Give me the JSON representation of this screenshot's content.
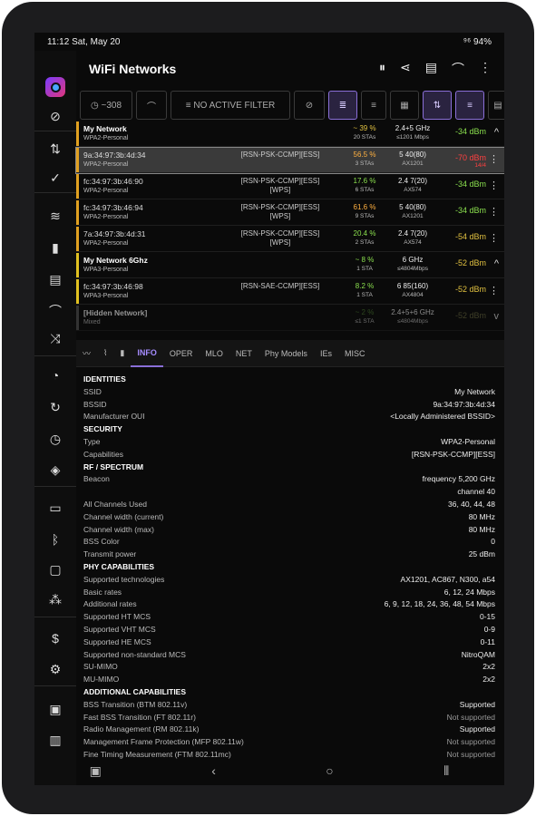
{
  "status": {
    "time": "11:12",
    "date": "Sat, May 20",
    "right": "⁹⁶ 94%"
  },
  "app": {
    "title": "WiFi Networks"
  },
  "filter": {
    "timer": "~308",
    "no_filter": "NO ACTIVE FILTER"
  },
  "networks": [
    {
      "kind": "group",
      "name": "My Network",
      "security": "WPA2-Personal",
      "ch": "~ 39 %",
      "ch_sub": "20 STAs",
      "freq": "2.4+5 GHz",
      "freq_sub": "≤1201 Mbps",
      "sig": "-34 dBm",
      "sig_sub": "",
      "color": "#e0a020",
      "sig_color": "#8be04e",
      "ch_color": "#e0c040",
      "tail": "^"
    },
    {
      "kind": "ap",
      "name": "9a:34:97:3b:4d:34",
      "security": "WPA2-Personal",
      "sec": "[RSN-PSK-CCMP][ESS]",
      "ch": "56.5 %",
      "ch_sub": "3 STAs",
      "freq": "5 40(80)",
      "freq_sub": "AX1201",
      "sig": "-70 dBm",
      "sig_sub": "14/4",
      "color": "#e0a020",
      "sig_color": "#ff4040",
      "ch_color": "#ffb040",
      "tail": "⋮",
      "selected": true
    },
    {
      "kind": "ap",
      "name": "fc:34:97:3b:46:90",
      "security": "WPA2-Personal",
      "sec": "[RSN-PSK-CCMP][ESS] [WPS]",
      "ch": "17.6 %",
      "ch_sub": "6 STAs",
      "freq": "2.4 7(20)",
      "freq_sub": "AX574",
      "sig": "-34 dBm",
      "sig_sub": "",
      "color": "#e0a020",
      "sig_color": "#8be04e",
      "ch_color": "#8be04e",
      "tail": "⋮"
    },
    {
      "kind": "ap",
      "name": "fc:34:97:3b:46:94",
      "security": "WPA2-Personal",
      "sec": "[RSN-PSK-CCMP][ESS] [WPS]",
      "ch": "61.6 %",
      "ch_sub": "9 STAs",
      "freq": "5 40(80)",
      "freq_sub": "AX1201",
      "sig": "-34 dBm",
      "sig_sub": "",
      "color": "#e0a020",
      "sig_color": "#8be04e",
      "ch_color": "#ffb040",
      "tail": "⋮"
    },
    {
      "kind": "ap",
      "name": "7a:34:97:3b:4d:31",
      "security": "WPA2-Personal",
      "sec": "[RSN-PSK-CCMP][ESS] [WPS]",
      "ch": "20.4 %",
      "ch_sub": "2 STAs",
      "freq": "2.4 7(20)",
      "freq_sub": "AX574",
      "sig": "-54 dBm",
      "sig_sub": "",
      "color": "#e0a020",
      "sig_color": "#e0c040",
      "ch_color": "#8be04e",
      "tail": "⋮"
    },
    {
      "kind": "group",
      "name": "My Network 6Ghz",
      "security": "WPA3-Personal",
      "ch": "~ 8 %",
      "ch_sub": "1 STA",
      "freq": "6 GHz",
      "freq_sub": "≤4804Mbps",
      "sig": "-52 dBm",
      "sig_sub": "",
      "color": "#e0c020",
      "sig_color": "#e0c040",
      "ch_color": "#8be04e",
      "tail": "^"
    },
    {
      "kind": "ap",
      "name": "fc:34:97:3b:46:98",
      "security": "WPA3-Personal",
      "sec": "[RSN-SAE-CCMP][ESS]",
      "ch": "8.2 %",
      "ch_sub": "1 STA",
      "freq": "6 85(160)",
      "freq_sub": "AX4804",
      "sig": "-52 dBm",
      "sig_sub": "",
      "color": "#e0c020",
      "sig_color": "#e0c040",
      "ch_color": "#8be04e",
      "tail": "⋮"
    },
    {
      "kind": "group",
      "name": "[Hidden Network]",
      "security": "Mixed",
      "ch": "~ 2 %",
      "ch_sub": "≤1 STA",
      "freq": "2.4+5+6 GHz",
      "freq_sub": "≤4804Mbps",
      "sig": "-52 dBm",
      "sig_sub": "",
      "color": "#555",
      "sig_color": "#6a6a40",
      "ch_color": "#4a7a30",
      "tail": "v",
      "dim": true
    }
  ],
  "tabs": [
    "INFO",
    "OPER",
    "MLO",
    "NET",
    "Phy Models",
    "IEs",
    "MISC"
  ],
  "info": [
    {
      "h": "IDENTITIES"
    },
    {
      "k": "SSID",
      "v": "My Network"
    },
    {
      "k": "BSSID",
      "v": "9a:34:97:3b:4d:34"
    },
    {
      "k": "Manufacturer OUI",
      "v": "<Locally Administered BSSID>"
    },
    {
      "h": "SECURITY"
    },
    {
      "k": "Type",
      "v": "WPA2-Personal"
    },
    {
      "k": "Capabilities",
      "v": "[RSN-PSK-CCMP][ESS]"
    },
    {
      "h": "RF / SPECTRUM"
    },
    {
      "k": "Beacon",
      "v": "frequency 5,200 GHz"
    },
    {
      "k": "",
      "v": "channel 40"
    },
    {
      "k": "All Channels Used",
      "v": "36, 40, 44, 48"
    },
    {
      "k": "Channel width (current)",
      "v": "80 MHz"
    },
    {
      "k": "Channel width (max)",
      "v": "80 MHz"
    },
    {
      "k": "BSS Color",
      "v": "0"
    },
    {
      "k": "Transmit power",
      "v": "25 dBm"
    },
    {
      "h": "PHY CAPABILITIES"
    },
    {
      "k": "Supported technologies",
      "v": "AX1201, AC867, N300, a54"
    },
    {
      "k": "Basic rates",
      "v": "6, 12, 24 Mbps"
    },
    {
      "k": "Additional rates",
      "v": "6, 9, 12, 18, 24, 36, 48, 54 Mbps"
    },
    {
      "k": "Supported HT MCS",
      "v": "0-15"
    },
    {
      "k": "Supported VHT MCS",
      "v": "0-9"
    },
    {
      "k": "Supported HE MCS",
      "v": "0-11"
    },
    {
      "k": "Supported non-standard MCS",
      "v": "NitroQAM"
    },
    {
      "k": "SU-MIMO",
      "v": "2x2"
    },
    {
      "k": "MU-MIMO",
      "v": "2x2"
    },
    {
      "h": "ADDITIONAL CAPABILITIES"
    },
    {
      "k": "BSS Transition (BTM 802.11v)",
      "v": "Supported"
    },
    {
      "k": "Fast BSS Transition (FT 802.11r)",
      "v": "Not supported",
      "dim": true
    },
    {
      "k": "Radio Management (RM 802.11k)",
      "v": "Supported"
    },
    {
      "k": "Management Frame Protection (MFP 802.11w)",
      "v": "Not supported",
      "dim": true
    },
    {
      "k": "Fine Timing Measurement (FTM 802.11mc)",
      "v": "Not supported",
      "dim": true
    }
  ]
}
